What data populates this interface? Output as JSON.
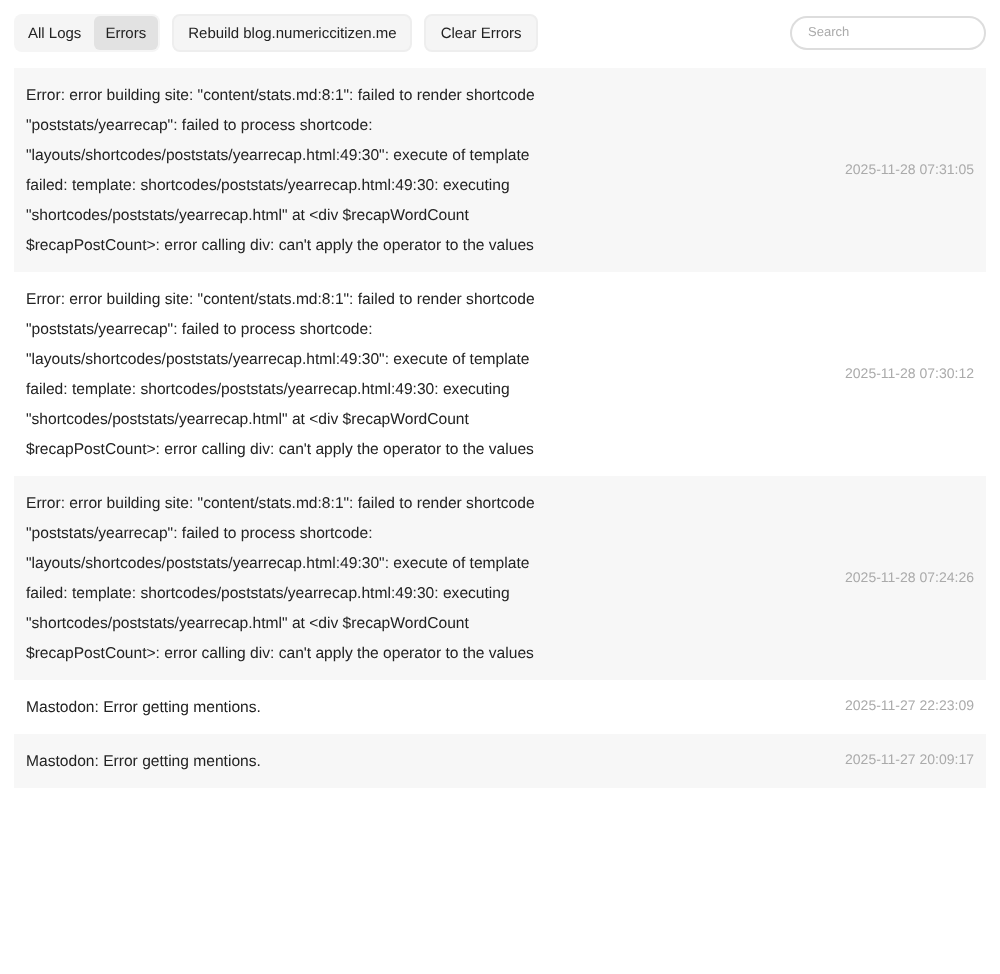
{
  "toolbar": {
    "filters": [
      {
        "label": "All Logs",
        "selected": false
      },
      {
        "label": "Errors",
        "selected": true
      }
    ],
    "buttons": [
      "Rebuild blog.numericcitizen.me",
      "Clear Errors"
    ],
    "search": {
      "placeholder": "Search"
    }
  },
  "logs": [
    {
      "message": "Error: error building site: \"content/stats.md:8:1\": failed to render shortcode \"poststats/yearrecap\": failed to process shortcode: \"layouts/shortcodes/poststats/yearrecap.html:49:30\": execute of template failed: template: shortcodes/poststats/yearrecap.html:49:30: executing \"shortcodes/poststats/yearrecap.html\" at <div $recapWordCount $recapPostCount>: error calling div: can't apply the operator to the values",
      "time": "2025-11-28 07:31:05"
    },
    {
      "message": "Error: error building site: \"content/stats.md:8:1\": failed to render shortcode \"poststats/yearrecap\": failed to process shortcode: \"layouts/shortcodes/poststats/yearrecap.html:49:30\": execute of template failed: template: shortcodes/poststats/yearrecap.html:49:30: executing \"shortcodes/poststats/yearrecap.html\" at <div $recapWordCount $recapPostCount>: error calling div: can't apply the operator to the values",
      "time": "2025-11-28 07:30:12"
    },
    {
      "message": "Error: error building site: \"content/stats.md:8:1\": failed to render shortcode \"poststats/yearrecap\": failed to process shortcode: \"layouts/shortcodes/poststats/yearrecap.html:49:30\": execute of template failed: template: shortcodes/poststats/yearrecap.html:49:30: executing \"shortcodes/poststats/yearrecap.html\" at <div $recapWordCount $recapPostCount>: error calling div: can't apply the operator to the values",
      "time": "2025-11-28 07:24:26"
    },
    {
      "message": "Mastodon: Error getting mentions.",
      "time": "2025-11-27 22:23:09"
    },
    {
      "message": "Mastodon: Error getting mentions.",
      "time": "2025-11-27 20:09:17"
    }
  ]
}
